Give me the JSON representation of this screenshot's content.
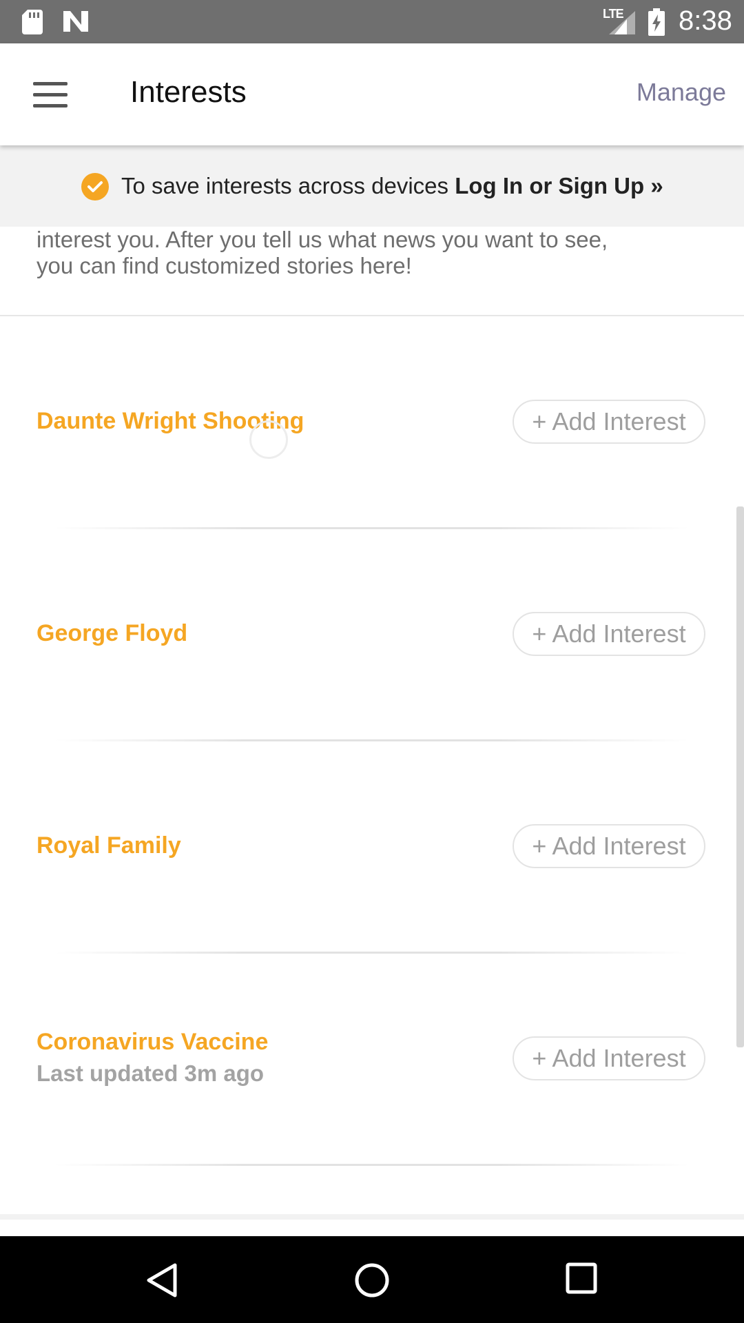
{
  "status_bar": {
    "time": "8:38",
    "network": "LTE",
    "icons": [
      "sd-card-icon",
      "n-notification-icon",
      "lte-signal-icon",
      "battery-charging-icon"
    ]
  },
  "app_bar": {
    "title": "Interests",
    "manage_label": "Manage",
    "menu_icon": "hamburger-menu-icon"
  },
  "login_banner": {
    "text": "To save interests across devices ",
    "link_label": "Log In or Sign Up »",
    "icon": "check-circle-icon",
    "accent_color": "#f5a623"
  },
  "intro": {
    "line1": "interest you. After you tell us what news you want to see,",
    "line2": "you can find customized stories here!"
  },
  "interests": [
    {
      "name": "Daunte Wright Shooting",
      "meta": "",
      "button_label": "+ Add Interest"
    },
    {
      "name": "George Floyd",
      "meta": "",
      "button_label": "+ Add Interest"
    },
    {
      "name": "Royal Family",
      "meta": "",
      "button_label": "+ Add Interest"
    },
    {
      "name": "Coronavirus Vaccine",
      "meta": "Last updated 3m ago",
      "button_label": "+ Add Interest"
    }
  ],
  "nav_bar": {
    "icons": [
      "back-triangle-icon",
      "home-circle-icon",
      "recents-square-icon"
    ]
  },
  "colors": {
    "accent": "#f5a623",
    "manage": "#7c7a99",
    "status_bar": "#6f6f6f"
  }
}
